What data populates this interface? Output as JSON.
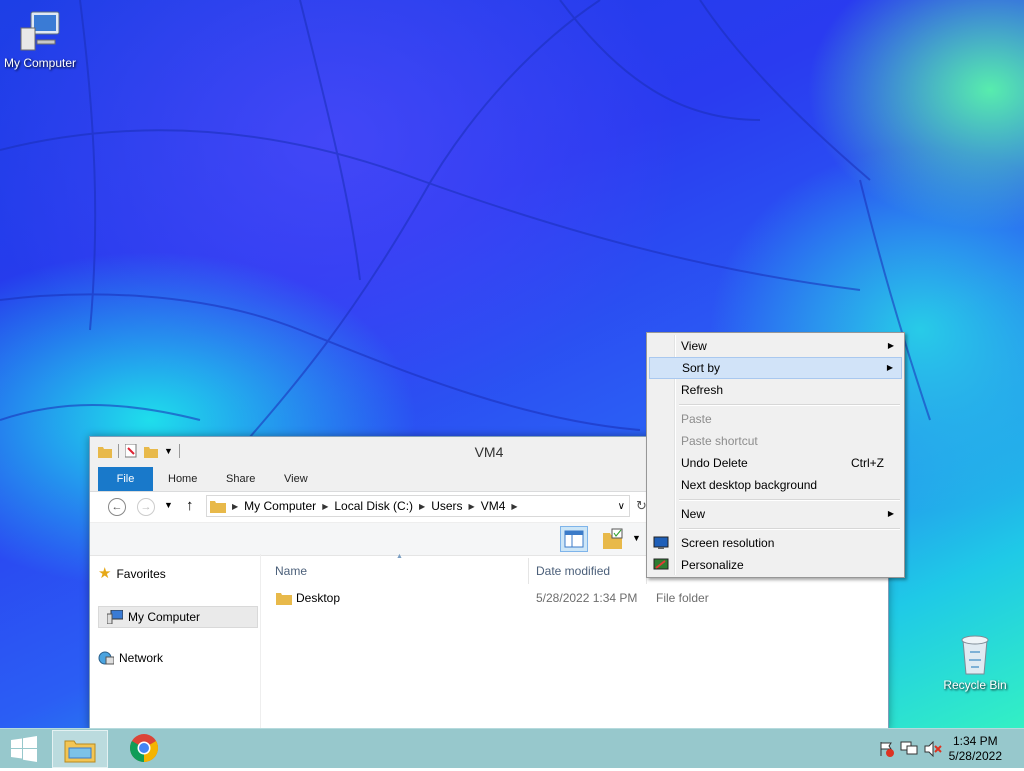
{
  "desktop": {
    "icons": [
      {
        "label": "My Computer",
        "icon": "computer-icon"
      },
      {
        "label": "Recycle Bin",
        "icon": "recycle-bin-icon"
      }
    ]
  },
  "explorer": {
    "title": "VM4",
    "ribbon_tabs": [
      "File",
      "Home",
      "Share",
      "View"
    ],
    "breadcrumb": [
      "My Computer",
      "Local Disk (C:)",
      "Users",
      "VM4"
    ],
    "nav_pane": [
      "Favorites",
      "My Computer",
      "Network"
    ],
    "columns": {
      "name": "Name",
      "date_modified": "Date modified"
    },
    "files": [
      {
        "name": "Desktop",
        "date": "5/28/2022 1:34 PM",
        "type": "File folder"
      }
    ]
  },
  "context_menu": {
    "items": [
      {
        "label": "View",
        "submenu": true
      },
      {
        "label": "Sort by",
        "submenu": true,
        "highlighted": true
      },
      {
        "label": "Refresh"
      },
      {
        "label": "Paste",
        "disabled": true
      },
      {
        "label": "Paste shortcut",
        "disabled": true
      },
      {
        "label": "Undo Delete",
        "shortcut": "Ctrl+Z"
      },
      {
        "label": "Next desktop background"
      },
      {
        "label": "New",
        "submenu": true
      },
      {
        "label": "Screen resolution",
        "icon": "monitor-icon"
      },
      {
        "label": "Personalize",
        "icon": "personalize-icon"
      }
    ]
  },
  "taskbar": {
    "clock_time": "1:34 PM",
    "clock_date": "5/28/2022"
  },
  "colors": {
    "accent": "#1979ca",
    "taskbar": "#97c8cc",
    "menu_highlight": "#d1e3f8"
  }
}
